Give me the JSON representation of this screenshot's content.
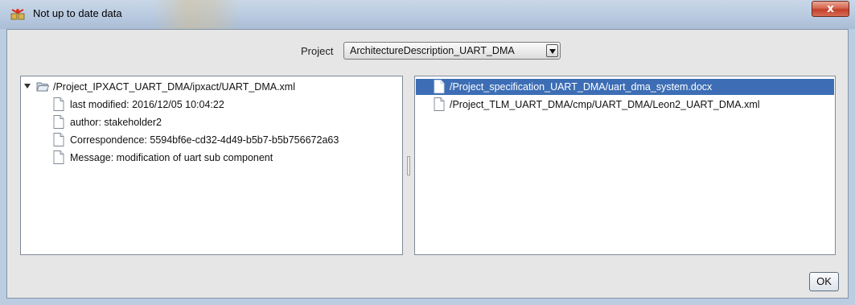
{
  "window": {
    "title": "Not up to date data",
    "close_label": "x",
    "app_icon": "not-up-to-date-icon"
  },
  "project": {
    "label": "Project",
    "selected": "ArchitectureDescription_UART_DMA"
  },
  "left_tree": {
    "root": {
      "label": "/Project_IPXACT_UART_DMA/ipxact/UART_DMA.xml",
      "expanded": true,
      "icon": "folder-icon"
    },
    "children": [
      "last modified: 2016/12/05 10:04:22",
      "author: stakeholder2",
      "Correspondence: 5594bf6e-cd32-4d49-b5b7-b5b756672a63",
      "Message: modification of uart sub component"
    ]
  },
  "right_list": {
    "items": [
      {
        "label": "/Project_specification_UART_DMA/uart_dma_system.docx",
        "selected": true
      },
      {
        "label": "/Project_TLM_UART_DMA/cmp/UART_DMA/Leon2_UART_DMA.xml",
        "selected": false
      }
    ]
  },
  "buttons": {
    "ok": "OK"
  },
  "colors": {
    "selection": "#3d6eb5",
    "close_button": "#c9432e",
    "title_bar": "#bccde2"
  }
}
